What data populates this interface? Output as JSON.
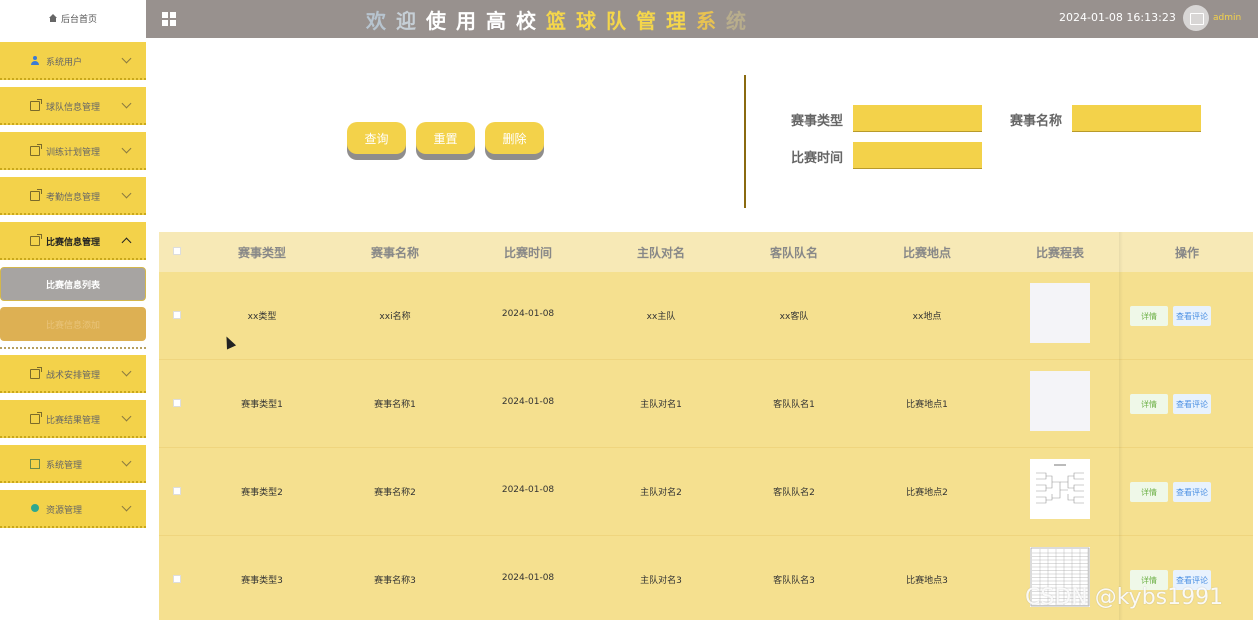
{
  "sidebar": {
    "home_label": "后台首页",
    "items": [
      {
        "label": "系统用户",
        "icon": "user-icon"
      },
      {
        "label": "球队信息管理",
        "icon": "document-icon"
      },
      {
        "label": "训练计划管理",
        "icon": "document-icon"
      },
      {
        "label": "考勤信息管理",
        "icon": "document-icon"
      },
      {
        "label": "比赛信息管理",
        "icon": "document-icon",
        "expanded": true
      },
      {
        "label": "战术安排管理",
        "icon": "document-icon"
      },
      {
        "label": "比赛结果管理",
        "icon": "document-icon"
      },
      {
        "label": "系统管理",
        "icon": "image-icon"
      },
      {
        "label": "资源管理",
        "icon": "bulb-icon"
      }
    ],
    "sub_items": [
      {
        "label": "比赛信息列表",
        "active": true
      },
      {
        "label": "比赛信息添加",
        "active": false
      }
    ]
  },
  "header": {
    "title_chars": [
      "欢",
      "迎",
      "使",
      "用",
      "高",
      "校",
      "篮",
      "球",
      "队",
      "管",
      "理",
      "系",
      "统"
    ],
    "title_colors": [
      "#b7c4cf",
      "#c6cfd6",
      "#ffffff",
      "#ffffff",
      "#ffffff",
      "#ffffff",
      "#f4d64b",
      "#f4d64b",
      "#f4d64b",
      "#f4d64b",
      "#f4d64b",
      "#e8c252",
      "#b8ad8c"
    ],
    "datetime": "2024-01-08 16:13:23",
    "username": "admin"
  },
  "search": {
    "buttons": {
      "query": "查询",
      "reset": "重置",
      "delete": "删除"
    },
    "fields": {
      "event_type_label": "赛事类型",
      "event_name_label": "赛事名称",
      "match_time_label": "比赛时间"
    }
  },
  "table": {
    "headers": [
      "赛事类型",
      "赛事名称",
      "比赛时间",
      "主队对名",
      "客队队名",
      "比赛地点",
      "比赛程表",
      "操作"
    ],
    "rows": [
      {
        "type": "xx类型",
        "name": "xxi名称",
        "time": "2024-01-08",
        "home": "xx主队",
        "away": "xx客队",
        "place": "xx地点",
        "thumb": "blank"
      },
      {
        "type": "赛事类型1",
        "name": "赛事名称1",
        "time": "2024-01-08",
        "home": "主队对名1",
        "away": "客队队名1",
        "place": "比赛地点1",
        "thumb": "blank"
      },
      {
        "type": "赛事类型2",
        "name": "赛事名称2",
        "time": "2024-01-08",
        "home": "主队对名2",
        "away": "客队队名2",
        "place": "比赛地点2",
        "thumb": "bracket"
      },
      {
        "type": "赛事类型3",
        "name": "赛事名称3",
        "time": "2024-01-08",
        "home": "主队对名3",
        "away": "客队队名3",
        "place": "比赛地点3",
        "thumb": "sheet"
      }
    ],
    "detail_label": "详情",
    "comment_label": "查看评论"
  },
  "watermark": "CSDN @kybs1991",
  "colors": {
    "accent": "#f3d24a",
    "topbar": "#98918e",
    "header_row": "#f7e9b6",
    "row": "#f5e08f"
  }
}
